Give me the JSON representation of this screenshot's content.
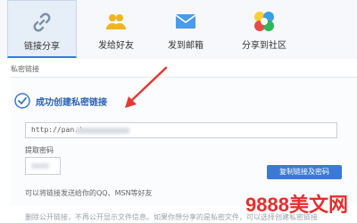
{
  "tabs": [
    {
      "label": "链接分享",
      "icon": "link-icon",
      "active": true
    },
    {
      "label": "发给好友",
      "icon": "friends-icon",
      "active": false
    },
    {
      "label": "发到邮箱",
      "icon": "mail-icon",
      "active": false
    },
    {
      "label": "分享到社区",
      "icon": "community-icon",
      "active": false
    }
  ],
  "section_title": "私密链接",
  "success_text": "成功创建私密链接",
  "link": {
    "value": "http://pan.'"
  },
  "code_label": "提取密码",
  "copy_button": "复制链接及密码",
  "hint": "可以将链接发送给你的QQ、MSN等好友",
  "bottom_text": "删除公开链接，不再公开显示文件信息。如果你想分享的是私密文件，可以选择创建私密链接",
  "watermark": "9888美文网",
  "colors": {
    "accent": "#3b79d6",
    "success": "#2a62b5",
    "watermark": "#e62e2e",
    "arrow": "#e53935"
  }
}
